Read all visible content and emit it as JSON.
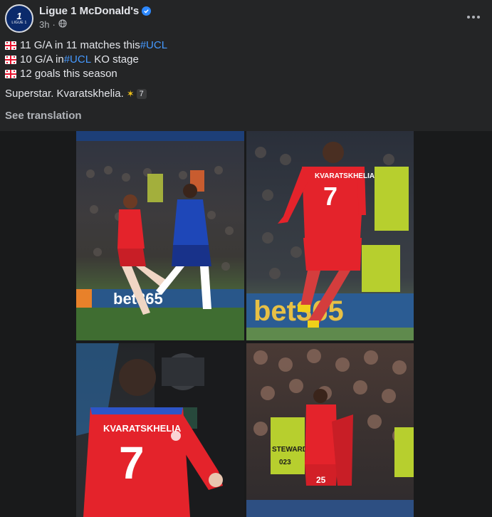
{
  "post": {
    "page_name": "Ligue 1 McDonald's",
    "time": "3h",
    "avatar_text": {
      "number": "1",
      "label": "LIGUE 1"
    },
    "lines": [
      {
        "before": "11 G/A in 11 matches this ",
        "hashtag": "#UCL",
        "after": ""
      },
      {
        "before": "10 G/A in ",
        "hashtag": "#UCL",
        "after": " KO stage"
      },
      {
        "before": "12 goals this season",
        "hashtag": "",
        "after": ""
      }
    ],
    "closing_text": "Superstar. Kvaratskhelia.",
    "closing_badge": "7",
    "see_translation": "See translation"
  },
  "photos": {
    "p1_ad_text": "bet365",
    "p2_ad_text": "bet365",
    "p2_shirt_name": "KVARATSKHELIA",
    "p2_shirt_number": "7",
    "p3_shirt_name": "KVARATSKHELIA",
    "p3_shirt_number": "7",
    "p4_steward_text": "STEWARD",
    "p4_steward_number": "023",
    "p4_player_number": "25"
  },
  "colors": {
    "background": "#242526",
    "text": "#e4e6eb",
    "muted": "#b0b3b8",
    "hashtag": "#4599ff",
    "verified": "#2d88ff",
    "psg_kit": "#e4232b",
    "chelsea_kit": "#1e47b8"
  },
  "icons": [
    "globe-icon",
    "verified-badge-icon",
    "more-options-icon",
    "georgia-flag-icon",
    "dizzy-icon"
  ]
}
